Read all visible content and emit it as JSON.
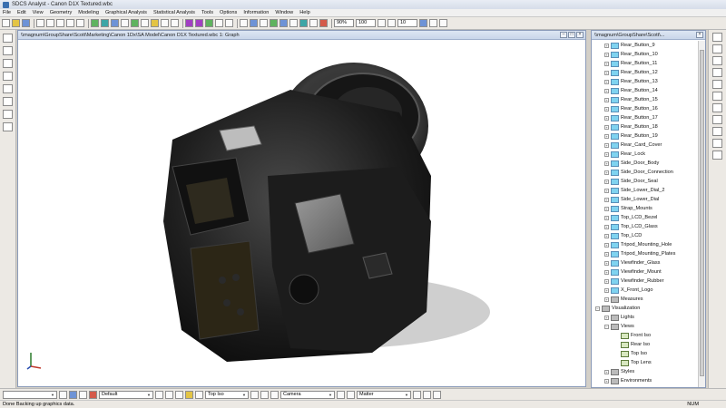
{
  "window": {
    "title": "SDCS Analyst - Canon D1X Textured.wbc"
  },
  "menu": [
    "File",
    "Edit",
    "View",
    "Geometry",
    "Modeling",
    "Graphical Analysis",
    "Statistical Analysis",
    "Tools",
    "Options",
    "Information",
    "Window",
    "Help"
  ],
  "toolbar": {
    "zoom_value": "90%",
    "size_value": "100",
    "count_value": "10"
  },
  "graph_window": {
    "title": "\\\\magnum\\GroupShare\\Scott\\Marketing\\Canon 1Dx\\SA Model\\Canon D1X Textured.wbc 1: Graph",
    "btn_min": "–",
    "btn_max": "□",
    "btn_close": "×"
  },
  "tree_panel": {
    "title": "\\\\magnum\\GroupShare\\Scott\\..."
  },
  "tree_items": [
    "Rear_Button_9",
    "Rear_Button_10",
    "Rear_Button_11",
    "Rear_Button_12",
    "Rear_Button_13",
    "Rear_Button_14",
    "Rear_Button_15",
    "Rear_Button_16",
    "Rear_Button_17",
    "Rear_Button_18",
    "Rear_Button_19",
    "Rear_Card_Cover",
    "Rear_Lock",
    "Side_Door_Body",
    "Side_Door_Connection",
    "Side_Door_Seal",
    "Side_Lower_Dial_2",
    "Side_Lower_Dial",
    "Strap_Mounts",
    "Top_LCD_Bezel",
    "Top_LCD_Glass",
    "Top_LCD",
    "Tripod_Mounting_Hole",
    "Tripod_Mounting_Plates",
    "Viewfinder_Glass",
    "Viewfinder_Mount",
    "Viewfinder_Rubber",
    "X_Front_Logo"
  ],
  "tree_sections": {
    "measures": "Measures",
    "visualization": "Visualization",
    "lights": "Lights",
    "views": "Views",
    "view_items": [
      "Front Iso",
      "Rear Iso",
      "Top Iso",
      "Top Lens"
    ],
    "styles": "Styles",
    "environments": "Environments"
  },
  "bottombar": {
    "first_select": "",
    "style": "Default",
    "view": "Top Iso",
    "light": "Camera",
    "material": "Matter"
  },
  "status": {
    "text": "Done Backing up graphics data.",
    "num": "NUM"
  }
}
